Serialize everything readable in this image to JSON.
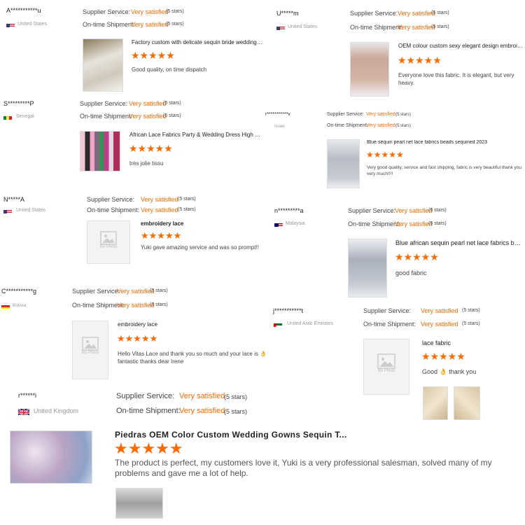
{
  "reviews": [
    {
      "buyer": "A***********u",
      "country": "United States",
      "supplier_label": "Supplier Service:",
      "supplier_value": "Very satisfied",
      "supplier_stars": "(5 stars)",
      "shipment_label": "On-time Shipment:",
      "shipment_value": "Very satisfied",
      "shipment_stars": "(5 stars)",
      "product_title": "Factory custom with delicate sequin bride wedding ve...",
      "rating": "★★★★★",
      "comment": "Good quality, on time dispatch"
    },
    {
      "buyer": "U*****m",
      "country": "United States",
      "supplier_label": "Supplier Service:",
      "supplier_value": "Very satisfied",
      "supplier_stars": "(5 stars)",
      "shipment_label": "On-time Shipment:",
      "shipment_value": "Very satisfied",
      "shipment_stars": "(5 stars)",
      "product_title": "OEM colour custom sexy elegant design embroidery b...",
      "rating": "★★★★★",
      "comment": "Everyone love this fabric. It is elegant, but very heavy."
    },
    {
      "buyer": "S*********P",
      "country": "Senegal",
      "supplier_label": "Supplier Service:",
      "supplier_value": "Very satisfied",
      "supplier_stars": "(5 stars)",
      "shipment_label": "On-time Shipment:",
      "shipment_value": "Very satisfied",
      "shipment_stars": "(5 stars)",
      "product_title": "African Lace Fabrics Party & Wedding Dress High Qua...",
      "rating": "★★★★★",
      "comment": "très jolie tissu"
    },
    {
      "buyer": "r***********v",
      "country": "Israel",
      "supplier_label": "Supplier Service:",
      "supplier_value": "Very satisfied",
      "supplier_stars": "(5 stars)",
      "shipment_label": "On-time Shipment:",
      "shipment_value": "Very satisfied",
      "shipment_stars": "(5 stars)",
      "product_title": "Blue sequin pearl net lace fabrics beads sequined 2023",
      "rating": "★★★★★",
      "comment": "Very good quality, service and fast shipping, fabric is very beautiful thank you very much!!!!"
    },
    {
      "buyer": "N*****A",
      "country": "United States",
      "supplier_label": "Supplier Service:",
      "supplier_value": "Very satisfied",
      "supplier_stars": "(5 stars)",
      "shipment_label": "On-time Shipment:",
      "shipment_value": "Very satisfied",
      "shipment_stars": "(5 stars)",
      "product_title": "embroidery lace",
      "rating": "★★★★★",
      "comment": "Yuki gave amazing service and was so prompt!!",
      "no_photo": "No Photo"
    },
    {
      "buyer": "n*********a",
      "country": "Malaysia",
      "supplier_label": "Supplier Service:",
      "supplier_value": "Very satisfied",
      "supplier_stars": "(5 stars)",
      "shipment_label": "On-time Shipment:",
      "shipment_value": "Very satisfied",
      "shipment_stars": "(5 stars)",
      "product_title": "Blue african sequin pearl net lace fabrics beads sequ...",
      "rating": "★★★★★",
      "comment": "good fabric"
    },
    {
      "buyer": "C***********g",
      "country": "Bolivia",
      "supplier_label": "Supplier Service:",
      "supplier_value": "Very satisfied",
      "supplier_stars": "(5 stars)",
      "shipment_label": "On-time Shipment:",
      "shipment_value": "Very satisfied",
      "shipment_stars": "(5 stars)",
      "product_title": "embroidery lace",
      "rating": "★★★★★",
      "comment": "Hello Vitas Lace and thank you so much and your lace is 👌fantastic thanks dear Irene",
      "no_photo": "No Photo"
    },
    {
      "buyer": "j***********t",
      "country": "United Arab Emirates",
      "supplier_label": "Supplier Service:",
      "supplier_value": "Very satisfied",
      "supplier_stars": "(5 stars)",
      "shipment_label": "On-time Shipment:",
      "shipment_value": "Very satisfied",
      "shipment_stars": "(5 stars)",
      "product_title": "lace fabric",
      "rating": "★★★★★",
      "comment": "Good 👌 thank you",
      "no_photo": "No Photo"
    },
    {
      "buyer": "r******i",
      "country": "United Kingdom",
      "supplier_label": "Supplier Service:",
      "supplier_value": "Very satisfied",
      "supplier_stars": "(5 stars)",
      "shipment_label": "On-time Shipment:",
      "shipment_value": "Very satisfied",
      "shipment_stars": "(5 stars)",
      "product_title": "Piedras OEM Color Custom Wedding Gowns Sequin T...",
      "rating": "★★★★★",
      "comment": "The product is perfect, my customers love it, Yuki is a very professional salesman, solved many of my problems and gave me a lot of help."
    }
  ],
  "colors": {
    "accent": "#ff6a00",
    "label": "#444444",
    "muted": "#999999"
  }
}
